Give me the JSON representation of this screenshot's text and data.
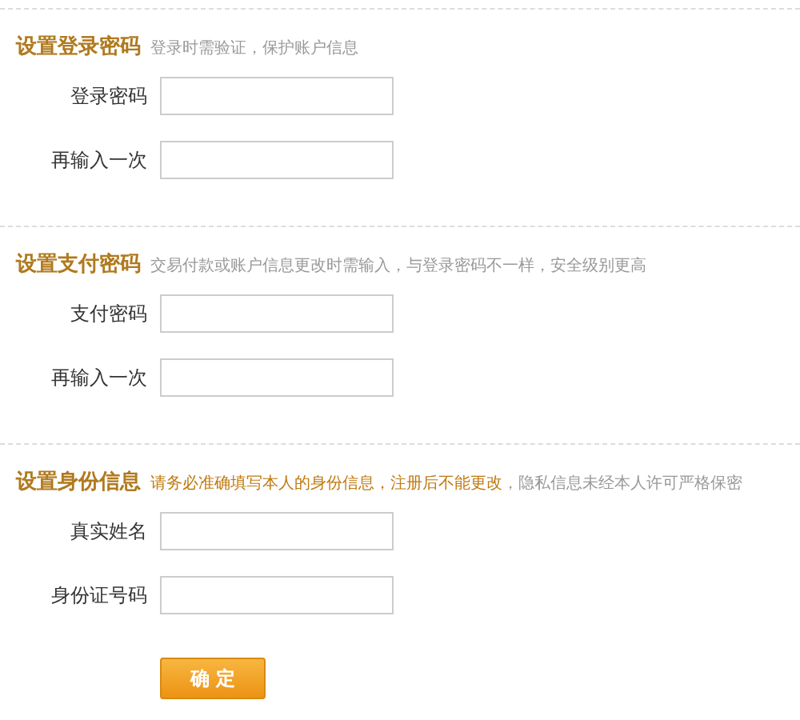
{
  "sections": [
    {
      "title": "设置登录密码",
      "hint": [
        {
          "text": "登录时需验证，保护账户信息",
          "emphasis": false
        }
      ],
      "fields": [
        {
          "label": "登录密码"
        },
        {
          "label": "再输入一次"
        }
      ]
    },
    {
      "title": "设置支付密码",
      "hint": [
        {
          "text": "交易付款或账户信息更改时需输入，与登录密码不一样，安全级别更高",
          "emphasis": false
        }
      ],
      "fields": [
        {
          "label": "支付密码"
        },
        {
          "label": "再输入一次"
        }
      ]
    },
    {
      "title": "设置身份信息",
      "hint": [
        {
          "text": "请务必准确填写本人的身份信息，注册后不能更改",
          "emphasis": true
        },
        {
          "text": "，隐私信息未经本人许可严格保密",
          "emphasis": false
        }
      ],
      "fields": [
        {
          "label": "真实姓名"
        },
        {
          "label": "身份证号码"
        }
      ]
    }
  ],
  "submit_button": "确 定"
}
